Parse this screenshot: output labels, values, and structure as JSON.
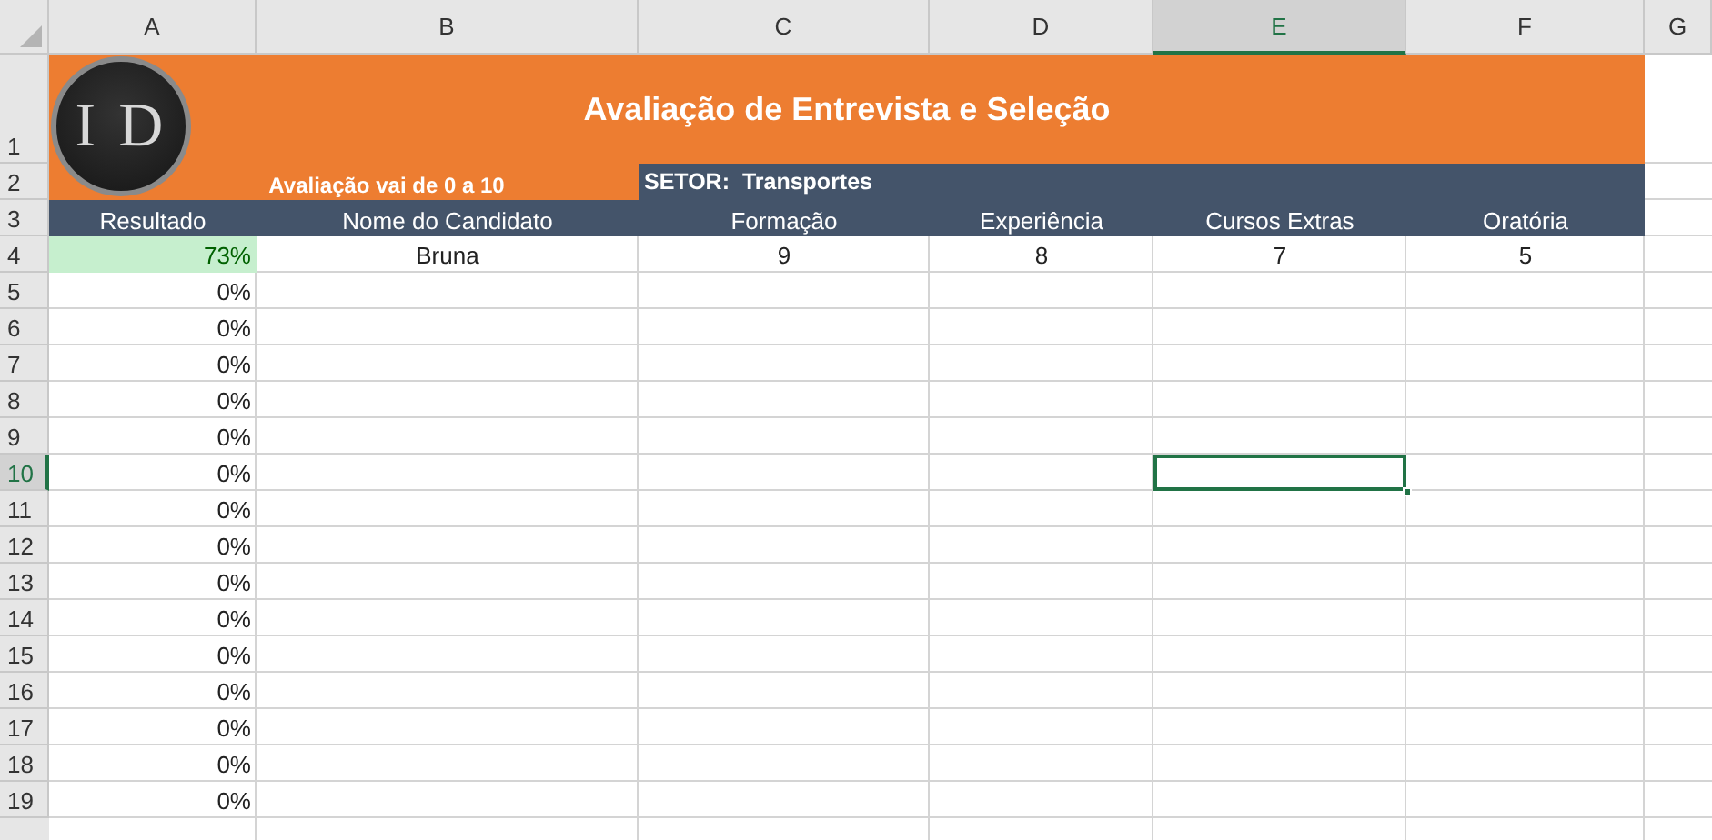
{
  "column_headers": [
    {
      "label": "A",
      "selected": false
    },
    {
      "label": "B",
      "selected": false
    },
    {
      "label": "C",
      "selected": false
    },
    {
      "label": "D",
      "selected": false
    },
    {
      "label": "E",
      "selected": true
    },
    {
      "label": "F",
      "selected": false
    },
    {
      "label": "G",
      "selected": false
    }
  ],
  "row_numbers": [
    {
      "label": "1",
      "selected": false
    },
    {
      "label": "2",
      "selected": false
    },
    {
      "label": "3",
      "selected": false
    },
    {
      "label": "4",
      "selected": false
    },
    {
      "label": "5",
      "selected": false
    },
    {
      "label": "6",
      "selected": false
    },
    {
      "label": "7",
      "selected": false
    },
    {
      "label": "8",
      "selected": false
    },
    {
      "label": "9",
      "selected": false
    },
    {
      "label": "10",
      "selected": true
    },
    {
      "label": "11",
      "selected": false
    },
    {
      "label": "12",
      "selected": false
    },
    {
      "label": "13",
      "selected": false
    },
    {
      "label": "14",
      "selected": false
    },
    {
      "label": "15",
      "selected": false
    },
    {
      "label": "16",
      "selected": false
    },
    {
      "label": "17",
      "selected": false
    },
    {
      "label": "18",
      "selected": false
    },
    {
      "label": "19",
      "selected": false
    }
  ],
  "logo": {
    "text": "I D"
  },
  "title": "Avaliação de Entrevista e Seleção",
  "scale_note": "Avaliação vai de 0 a 10",
  "sector": "SETOR:  Transportes",
  "headers": [
    "Resultado",
    "Nome do Candidato",
    "Formação",
    "Experiência",
    "Cursos Extras",
    "Oratória"
  ],
  "rows": [
    {
      "cells": [
        "73%",
        "Bruna",
        "9",
        "8",
        "7",
        "5"
      ],
      "highlighted": true
    },
    {
      "cells": [
        "0%"
      ],
      "highlighted": false
    },
    {
      "cells": [
        "0%"
      ],
      "highlighted": false
    },
    {
      "cells": [
        "0%"
      ],
      "highlighted": false
    },
    {
      "cells": [
        "0%"
      ],
      "highlighted": false
    },
    {
      "cells": [
        "0%"
      ],
      "highlighted": false
    },
    {
      "cells": [
        "0%"
      ],
      "highlighted": false
    },
    {
      "cells": [
        "0%"
      ],
      "highlighted": false
    },
    {
      "cells": [
        "0%"
      ],
      "highlighted": false
    },
    {
      "cells": [
        "0%"
      ],
      "highlighted": false
    },
    {
      "cells": [
        "0%"
      ],
      "highlighted": false
    },
    {
      "cells": [
        "0%"
      ],
      "highlighted": false
    },
    {
      "cells": [
        "0%"
      ],
      "highlighted": false
    },
    {
      "cells": [
        "0%"
      ],
      "highlighted": false
    },
    {
      "cells": [
        "0%"
      ],
      "highlighted": false
    },
    {
      "cells": [
        "0%"
      ],
      "highlighted": false
    }
  ]
}
